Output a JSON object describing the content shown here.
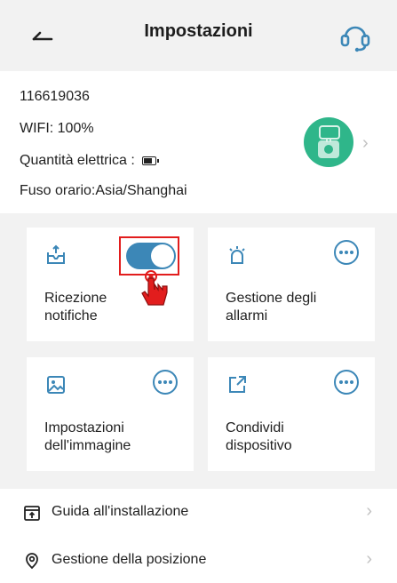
{
  "header": {
    "title": "Impostazioni"
  },
  "device": {
    "id": "116619036",
    "wifi": "WIFI:  100%",
    "battery_label": "Quantità elettrica :",
    "timezone": "Fuso orario:Asia/Shanghai"
  },
  "cards": {
    "notifications": {
      "label_line1": "Ricezione",
      "label_line2": "notifiche",
      "toggle_on": true
    },
    "alarms": {
      "label_line1": "Gestione degli",
      "label_line2": "allarmi"
    },
    "image": {
      "label_line1": "Impostazioni",
      "label_line2": "dell'immagine"
    },
    "share": {
      "label_line1": "Condividi",
      "label_line2": "dispositivo"
    }
  },
  "list": [
    {
      "label": "Guida all'installazione",
      "icon": "install-guide-icon"
    },
    {
      "label": "Gestione della posizione",
      "icon": "location-icon"
    }
  ],
  "colors": {
    "accent": "#3c87b7",
    "avatar": "#2fb68a",
    "highlight": "#e21d1d"
  }
}
